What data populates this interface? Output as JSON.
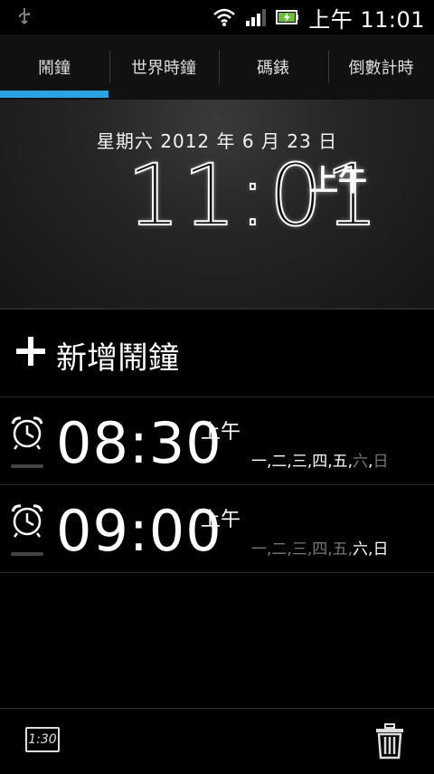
{
  "statusbar": {
    "time": "上午 11:01"
  },
  "tabs": [
    {
      "label": "鬧鐘"
    },
    {
      "label": "世界時鐘"
    },
    {
      "label": "碼錶"
    },
    {
      "label": "倒數計時"
    }
  ],
  "header": {
    "date": "星期六  2012 年 6 月 23 日",
    "time": "11:01",
    "ampm": "上午"
  },
  "add_alarm": {
    "label": "新增鬧鐘"
  },
  "alarms": [
    {
      "time": "08:30",
      "ampm": "上午",
      "days": [
        {
          "label": "一",
          "on": true
        },
        {
          "label": "二",
          "on": true
        },
        {
          "label": "三",
          "on": true
        },
        {
          "label": "四",
          "on": true
        },
        {
          "label": "五",
          "on": true
        },
        {
          "label": "六",
          "on": false
        },
        {
          "label": "日",
          "on": false
        }
      ]
    },
    {
      "time": "09:00",
      "ampm": "上午",
      "days": [
        {
          "label": "一",
          "on": false
        },
        {
          "label": "二",
          "on": false
        },
        {
          "label": "三",
          "on": false
        },
        {
          "label": "四",
          "on": false
        },
        {
          "label": "五",
          "on": false
        },
        {
          "label": "六",
          "on": true
        },
        {
          "label": "日",
          "on": true
        }
      ]
    }
  ],
  "bottombar": {
    "clock_button_label": "1:30"
  },
  "colors": {
    "accent": "#2aa3e0"
  }
}
